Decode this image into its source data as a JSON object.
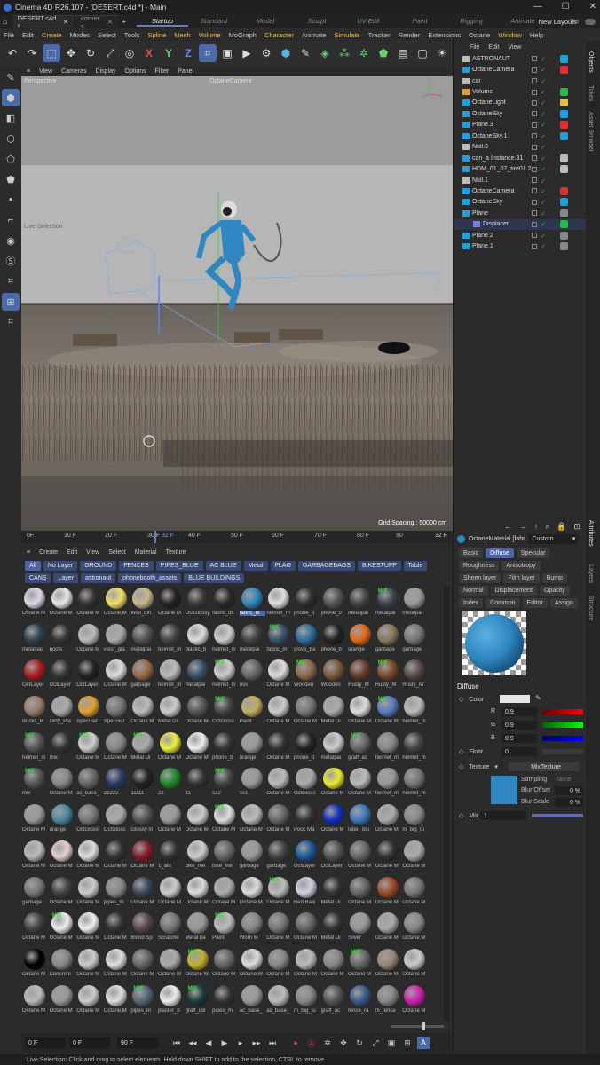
{
  "window": {
    "title": "Cinema 4D R26.107 - [DESERT.c4d *] - Main"
  },
  "tabs": [
    {
      "label": "DESERT.c4d *",
      "active": true
    },
    {
      "label": "corner s",
      "active": false
    }
  ],
  "layouts": [
    "Startup",
    "Standard",
    "Model",
    "Sculpt",
    "UV Edit",
    "Paint",
    "Rigging",
    "Animate",
    "Tra"
  ],
  "new_layouts": "New Layouts",
  "menu": [
    "File",
    "Edit",
    "Create",
    "Modes",
    "Select",
    "Tools",
    "Spline",
    "Mesh",
    "Volume",
    "MoGraph",
    "Character",
    "Animate",
    "Simulate",
    "Tracker",
    "Render",
    "Extensions",
    "Octane",
    "Window",
    "Help"
  ],
  "menu_highlight": [
    "Create",
    "Spline",
    "Mesh",
    "Volume",
    "Character",
    "Simulate",
    "Window"
  ],
  "toolbar_axes": [
    "X",
    "Y",
    "Z"
  ],
  "viewport": {
    "menu": [
      "View",
      "Cameras",
      "Display",
      "Options",
      "Filter",
      "Panel"
    ],
    "label": "Perspective",
    "camera": "OctaneCamera",
    "live_selection": "Live Selection",
    "grid_spacing": "Grid Spacing : 50000 cm"
  },
  "timeline": {
    "ticks": [
      "0F",
      "10 F",
      "20 F",
      "30 F",
      "32 F",
      "40 F",
      "50 F",
      "60 F",
      "70 F",
      "80 F",
      "90"
    ],
    "current": "32 F"
  },
  "material_menu": [
    "Create",
    "Edit",
    "View",
    "Select",
    "Material",
    "Texture"
  ],
  "filters": [
    "All",
    "No Layer",
    "GROUND",
    "FENCES",
    "PIPES_BLUE",
    "AC BLUE",
    "Metal",
    "FLAG",
    "GARBAGEBAGS",
    "BIKESTUFF",
    "Table",
    "CANS",
    "Layer",
    "astronaut",
    "phonebooth_assets",
    "BLUE BUILDINGS"
  ],
  "materials": [
    {
      "label": "Octane M",
      "color": "#d9d9e8"
    },
    {
      "label": "Octane M",
      "color": "#e8e8e8"
    },
    {
      "label": "Octane M",
      "color": "#333"
    },
    {
      "label": "Octane M",
      "color": "#f2e06a"
    },
    {
      "label": "Wall_dirt",
      "color": "#c9b98f"
    },
    {
      "label": "Octane M",
      "color": "#222"
    },
    {
      "label": "OctGlossy",
      "color": "#3a3a3a"
    },
    {
      "label": "fabric_dir",
      "color": "#2a2a2a"
    },
    {
      "label": "fabric_bl",
      "color": "#2f86c0"
    },
    {
      "label": "helmet_m",
      "color": "#e0e0e0"
    },
    {
      "label": "phone_b",
      "color": "#2e2e2e"
    },
    {
      "label": "phone_b",
      "color": "#555"
    },
    {
      "label": "metalpai",
      "color": "#444"
    },
    {
      "label": "metalpai",
      "color": "#3a4550"
    },
    {
      "label": "metalpai",
      "color": "#999"
    },
    {
      "label": "metalpai",
      "color": "#2f4555"
    },
    {
      "label": "boots",
      "color": "#333"
    },
    {
      "label": "Octane M",
      "color": "#bbb"
    },
    {
      "label": "visor_gla",
      "color": "#aaa"
    },
    {
      "label": "metalpai",
      "color": "#555"
    },
    {
      "label": "helmet_m",
      "color": "#444"
    },
    {
      "label": "plastic_b",
      "color": "#ddd"
    },
    {
      "label": "helmet_m",
      "color": "#ccc"
    },
    {
      "label": "metalpai",
      "color": "#444"
    },
    {
      "label": "fabric_m",
      "color": "#38506a"
    },
    {
      "label": "glove_ba",
      "color": "#2e6fa0"
    },
    {
      "label": "phone_b",
      "color": "#222"
    },
    {
      "label": "orange",
      "color": "#e06a1a"
    },
    {
      "label": "garbage",
      "color": "#8a7a60"
    },
    {
      "label": "garbage",
      "color": "#777"
    },
    {
      "label": "OctLayer",
      "color": "#b31c1c"
    },
    {
      "label": "OctLayer",
      "color": "#333"
    },
    {
      "label": "OctLayer",
      "color": "#222"
    },
    {
      "label": "Octane M",
      "color": "#ddd"
    },
    {
      "label": "garbage",
      "color": "#9a6a4a"
    },
    {
      "label": "helmet_m",
      "color": "#bbb"
    },
    {
      "label": "metalpai",
      "color": "#38506a"
    },
    {
      "label": "helmet_m",
      "color": "#ccc"
    },
    {
      "label": "mix",
      "color": "#666"
    },
    {
      "label": "Octane M",
      "color": "#ddd"
    },
    {
      "label": "Wooden",
      "color": "#8a6a4a"
    },
    {
      "label": "Wooden",
      "color": "#7a5a3a"
    },
    {
      "label": "Rusty_M",
      "color": "#6a3a2a"
    },
    {
      "label": "Rusty_M",
      "color": "#7a4a2a"
    },
    {
      "label": "Rusty_M",
      "color": "#5a4a4a"
    },
    {
      "label": "Bricks_R",
      "color": "#9a7a6a"
    },
    {
      "label": "Dirty_Pla",
      "color": "#aaa"
    },
    {
      "label": "Specular",
      "color": "#e0a030"
    },
    {
      "label": "Specular",
      "color": "#777"
    },
    {
      "label": "Octane M",
      "color": "#bbb"
    },
    {
      "label": "Metal Di",
      "color": "#ccc"
    },
    {
      "label": "Octane M",
      "color": "#555"
    },
    {
      "label": "OctGloss",
      "color": "#444"
    },
    {
      "label": "Paint",
      "color": "#c0b060"
    },
    {
      "label": "Octane M",
      "color": "#ccc"
    },
    {
      "label": "Octane M",
      "color": "#777"
    },
    {
      "label": "Metal Di",
      "color": "#aaa"
    },
    {
      "label": "Octane M",
      "color": "#ddd"
    },
    {
      "label": "Octane M",
      "color": "#5a7ac0"
    },
    {
      "label": "helmet_m",
      "color": "#bbb"
    },
    {
      "label": "helmet_m",
      "color": "#555"
    },
    {
      "label": "mix",
      "color": "#333"
    },
    {
      "label": "Octane M",
      "color": "#ccc"
    },
    {
      "label": "Octane M",
      "color": "#888"
    },
    {
      "label": "Metal Di",
      "color": "#aaa"
    },
    {
      "label": "Octane M",
      "color": "#eeee40"
    },
    {
      "label": "Octane M",
      "color": "#eee"
    },
    {
      "label": "phone_b",
      "color": "#333"
    },
    {
      "label": "orange",
      "color": "#999"
    },
    {
      "label": "Octane M",
      "color": "#333"
    },
    {
      "label": "phone_b",
      "color": "#222"
    },
    {
      "label": "metalpai",
      "color": "#ccc"
    },
    {
      "label": "graff_ac",
      "color": "#666"
    },
    {
      "label": "helmet_m",
      "color": "#888"
    },
    {
      "label": "helmet_m",
      "color": "#444"
    },
    {
      "label": "mix",
      "color": "#555"
    },
    {
      "label": "Octane M",
      "color": "#888"
    },
    {
      "label": "ac_base_",
      "color": "#666"
    },
    {
      "label": "22222",
      "color": "#2a3a6a"
    },
    {
      "label": "11111",
      "color": "#222"
    },
    {
      "label": "22",
      "color": "#1e8a2a"
    },
    {
      "label": "11",
      "color": "#333"
    },
    {
      "label": "s22",
      "color": "#444"
    },
    {
      "label": "ss1",
      "color": "#999"
    },
    {
      "label": "Octane M",
      "color": "#bbb"
    },
    {
      "label": "OctGloss",
      "color": "#aaa"
    },
    {
      "label": "Octane M",
      "color": "#eaea30"
    },
    {
      "label": "Octane M",
      "color": "#bbb"
    },
    {
      "label": "helmet_m",
      "color": "#999"
    },
    {
      "label": "helmet_m",
      "color": "#777"
    },
    {
      "label": "Octane M",
      "color": "#999"
    },
    {
      "label": "orange",
      "color": "#4a8aa0"
    },
    {
      "label": "OctGloss",
      "color": "#777"
    },
    {
      "label": "OctGloss",
      "color": "#aaa"
    },
    {
      "label": "Glossy m",
      "color": "#555"
    },
    {
      "label": "Octane M",
      "color": "#999"
    },
    {
      "label": "Octane M",
      "color": "#ccc"
    },
    {
      "label": "Octane M",
      "color": "#ddd"
    },
    {
      "label": "Octane M",
      "color": "#bbb"
    },
    {
      "label": "Octane M",
      "color": "#666"
    },
    {
      "label": "Pock Ma",
      "color": "#333"
    },
    {
      "label": "Octane M",
      "color": "#1030c0"
    },
    {
      "label": "label_blu",
      "color": "#3a7ac0"
    },
    {
      "label": "Octane M",
      "color": "#aaa"
    },
    {
      "label": "m_big_tu",
      "color": "#888"
    },
    {
      "label": "Octane M",
      "color": "#bbb"
    },
    {
      "label": "Octane M",
      "color": "#e8d0d0"
    },
    {
      "label": "Octane M",
      "color": "#ddd"
    },
    {
      "label": "Octane M",
      "color": "#333"
    },
    {
      "label": "Octane M",
      "color": "#8a1a2a"
    },
    {
      "label": "1_alu",
      "color": "#333"
    },
    {
      "label": "bike_me",
      "color": "#ccc"
    },
    {
      "label": "bike_me",
      "color": "#666"
    },
    {
      "label": "garbage",
      "color": "#999"
    },
    {
      "label": "garbage",
      "color": "#444"
    },
    {
      "label": "OctLayer",
      "color": "#1a5a9a"
    },
    {
      "label": "OctLayer",
      "color": "#555"
    },
    {
      "label": "Octane M",
      "color": "#666"
    },
    {
      "label": "Octane M",
      "color": "#333"
    },
    {
      "label": "Octane M",
      "color": "#aaa"
    },
    {
      "label": "garbage",
      "color": "#777"
    },
    {
      "label": "Octane M",
      "color": "#444"
    },
    {
      "label": "Octane M",
      "color": "#ccc"
    },
    {
      "label": "pipes_m",
      "color": "#888"
    },
    {
      "label": "Octane M",
      "color": "#3a4a5a"
    },
    {
      "label": "Octane M",
      "color": "#ccc"
    },
    {
      "label": "Octane M",
      "color": "#ddd"
    },
    {
      "label": "Octane M",
      "color": "#aaa"
    },
    {
      "label": "Octane M",
      "color": "#ddd"
    },
    {
      "label": "Octane M",
      "color": "#bbb"
    },
    {
      "label": "Red Balk",
      "color": "#d0d0e0"
    },
    {
      "label": "Metal Di",
      "color": "#333"
    },
    {
      "label": "Octane M",
      "color": "#666"
    },
    {
      "label": "Octane M",
      "color": "#a04a2a"
    },
    {
      "label": "Octane M",
      "color": "#777"
    },
    {
      "label": "Octane M",
      "color": "#444"
    },
    {
      "label": "Octane M",
      "color": "#eee"
    },
    {
      "label": "Octane M",
      "color": "#eee"
    },
    {
      "label": "Octane M",
      "color": "#333"
    },
    {
      "label": "Blood Sp",
      "color": "#5a4a4a"
    },
    {
      "label": "Scratche",
      "color": "#777"
    },
    {
      "label": "Metal ba",
      "color": "#999"
    },
    {
      "label": "Paint",
      "color": "#bbb"
    },
    {
      "label": "Worn M",
      "color": "#888"
    },
    {
      "label": "Octane M",
      "color": "#777"
    },
    {
      "label": "Octane M",
      "color": "#666"
    },
    {
      "label": "Metal Di",
      "color": "#333"
    },
    {
      "label": "Silver",
      "color": "#999"
    },
    {
      "label": "Octane M",
      "color": "#aaa"
    },
    {
      "label": "Octane M",
      "color": "#888"
    },
    {
      "label": "Octane M",
      "color": "#000"
    },
    {
      "label": "Concrete",
      "color": "#888"
    },
    {
      "label": "Octane M",
      "color": "#ccc"
    },
    {
      "label": "Octane M",
      "color": "#ddd"
    },
    {
      "label": "Octane M",
      "color": "#666"
    },
    {
      "label": "Octane M",
      "color": "#aaa"
    },
    {
      "label": "Octane M",
      "color": "#c0b030"
    },
    {
      "label": "Octane M",
      "color": "#666"
    },
    {
      "label": "Octane M",
      "color": "#ddd"
    },
    {
      "label": "Octane M",
      "color": "#888"
    },
    {
      "label": "Octane M",
      "color": "#bbb"
    },
    {
      "label": "Octane M",
      "color": "#888"
    },
    {
      "label": "Octane M",
      "color": "#666"
    },
    {
      "label": "Octane M",
      "color": "#998877"
    },
    {
      "label": "Octane M",
      "color": "#ccc"
    },
    {
      "label": "Octane M",
      "color": "#bbb"
    },
    {
      "label": "Octane M",
      "color": "#999"
    },
    {
      "label": "Octane M",
      "color": "#ccc"
    },
    {
      "label": "Octane M",
      "color": "#ddd"
    },
    {
      "label": "pipes_m",
      "color": "#556677"
    },
    {
      "label": "plaster_b",
      "color": "#eee"
    },
    {
      "label": "graff_col",
      "color": "#1a3a3a"
    },
    {
      "label": "pipes_m",
      "color": "#333"
    },
    {
      "label": "ac_base_",
      "color": "#999"
    },
    {
      "label": "ac_base_",
      "color": "#bbb"
    },
    {
      "label": "m_big_tu",
      "color": "#888"
    },
    {
      "label": "graff_ac",
      "color": "#555"
    },
    {
      "label": "fence_ra",
      "color": "#3a5a8a"
    },
    {
      "label": "m_fence",
      "color": "#888"
    },
    {
      "label": "Octane M",
      "color": "#d020b0"
    }
  ],
  "mix_indices": [
    13,
    24,
    37,
    40,
    43,
    52,
    58,
    60,
    62,
    64,
    72,
    75,
    82,
    97,
    129,
    136,
    142,
    156,
    162,
    169,
    171
  ],
  "playback": {
    "start": "0 F",
    "current": "0 F",
    "end": "90 F"
  },
  "status": "Live Selection: Click and drag to select elements. Hold down SHIFT to add to the selection, CTRL to remove.",
  "object_manager": {
    "menu": [
      "File",
      "Edit",
      "View"
    ],
    "objects": [
      {
        "name": "ASTRONAUT",
        "color": "#bbb",
        "tag": "#1aa0e0"
      },
      {
        "name": "OctaneCamera",
        "color": "#1aa0e0",
        "tag": "#e03030"
      },
      {
        "name": "car",
        "color": "#bbb",
        "tag": ""
      },
      {
        "name": "Volume",
        "color": "#e0a040",
        "tag": "#20c040"
      },
      {
        "name": "OctaneLight",
        "color": "#1aa0e0",
        "tag": "#e0c040"
      },
      {
        "name": "OctaneSky",
        "color": "#1aa0e0",
        "tag": "#1aa0e0"
      },
      {
        "name": "Plane.3",
        "color": "#1aa0e0",
        "tag": "#e03030"
      },
      {
        "name": "OctaneSky.1",
        "color": "#1aa0e0",
        "tag": "#1aa0e0"
      },
      {
        "name": "Null.3",
        "color": "#bbb",
        "tag": ""
      },
      {
        "name": "can_a Instance.31",
        "color": "#1aa0e0",
        "tag": "#bbb"
      },
      {
        "name": "HDM_01_07_tire01.2",
        "color": "#1aa0e0",
        "tag": "#bbb"
      },
      {
        "name": "Null.1",
        "color": "#bbb",
        "tag": ""
      },
      {
        "name": "OctaneCamera",
        "color": "#1aa0e0",
        "tag": "#e03030"
      },
      {
        "name": "OctaneSky",
        "color": "#1aa0e0",
        "tag": "#1aa0e0"
      },
      {
        "name": "Plane",
        "color": "#1aa0e0",
        "tag": "#888"
      },
      {
        "name": "Displacer",
        "color": "#8080e0",
        "tag": "#20c040"
      },
      {
        "name": "Plane.2",
        "color": "#1aa0e0",
        "tag": "#888"
      },
      {
        "name": "Plane.1",
        "color": "#1aa0e0",
        "tag": "#888"
      }
    ]
  },
  "side_tabs": [
    "Objects",
    "Takes",
    "Asset Browser",
    "Attributes",
    "Layers",
    "Structure"
  ],
  "attributes": {
    "material_name": "OctaneMaterial [fabr",
    "mode": "Custom",
    "channels": [
      "Basic",
      "Diffuse",
      "Specular",
      "Roughness",
      "Anisotropy",
      "Sheen layer",
      "Film layer",
      "Bump",
      "Normal",
      "Displacement",
      "Opacity",
      "Index",
      "Common",
      "Editor",
      "Assign"
    ],
    "active_channel": "Diffuse",
    "section": "Diffuse",
    "color_label": "Color",
    "r": {
      "label": "R",
      "value": "0.9"
    },
    "g": {
      "label": "G",
      "value": "0.9"
    },
    "b": {
      "label": "B",
      "value": "0.9"
    },
    "float_label": "Float",
    "float_value": "0",
    "texture_label": "Texture",
    "texture_value": "MixTexture",
    "sampling_label": "Sampling",
    "sampling_value": "None",
    "blur_offset_label": "Blur Offset",
    "blur_offset_value": "0 %",
    "blur_scale_label": "Blur Scale",
    "blur_scale_value": "0 %",
    "mix_label": "Mix",
    "mix_value": "1."
  },
  "colors": {
    "accent": "#4a6ba8",
    "chip": "#3a4a78",
    "mix": "#33dd33",
    "fabric": "#2f86c0"
  }
}
